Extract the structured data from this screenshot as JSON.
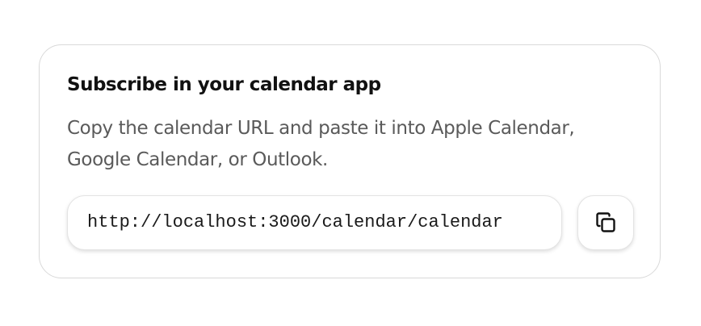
{
  "subscribe": {
    "title": "Subscribe in your calendar app",
    "description_lines": [
      "Copy the calendar URL and paste it into Apple Calendar,",
      "Google Calendar, or Outlook."
    ],
    "url": "http://localhost:3000/calendar/calendar",
    "copy_icon": "copy-icon"
  }
}
